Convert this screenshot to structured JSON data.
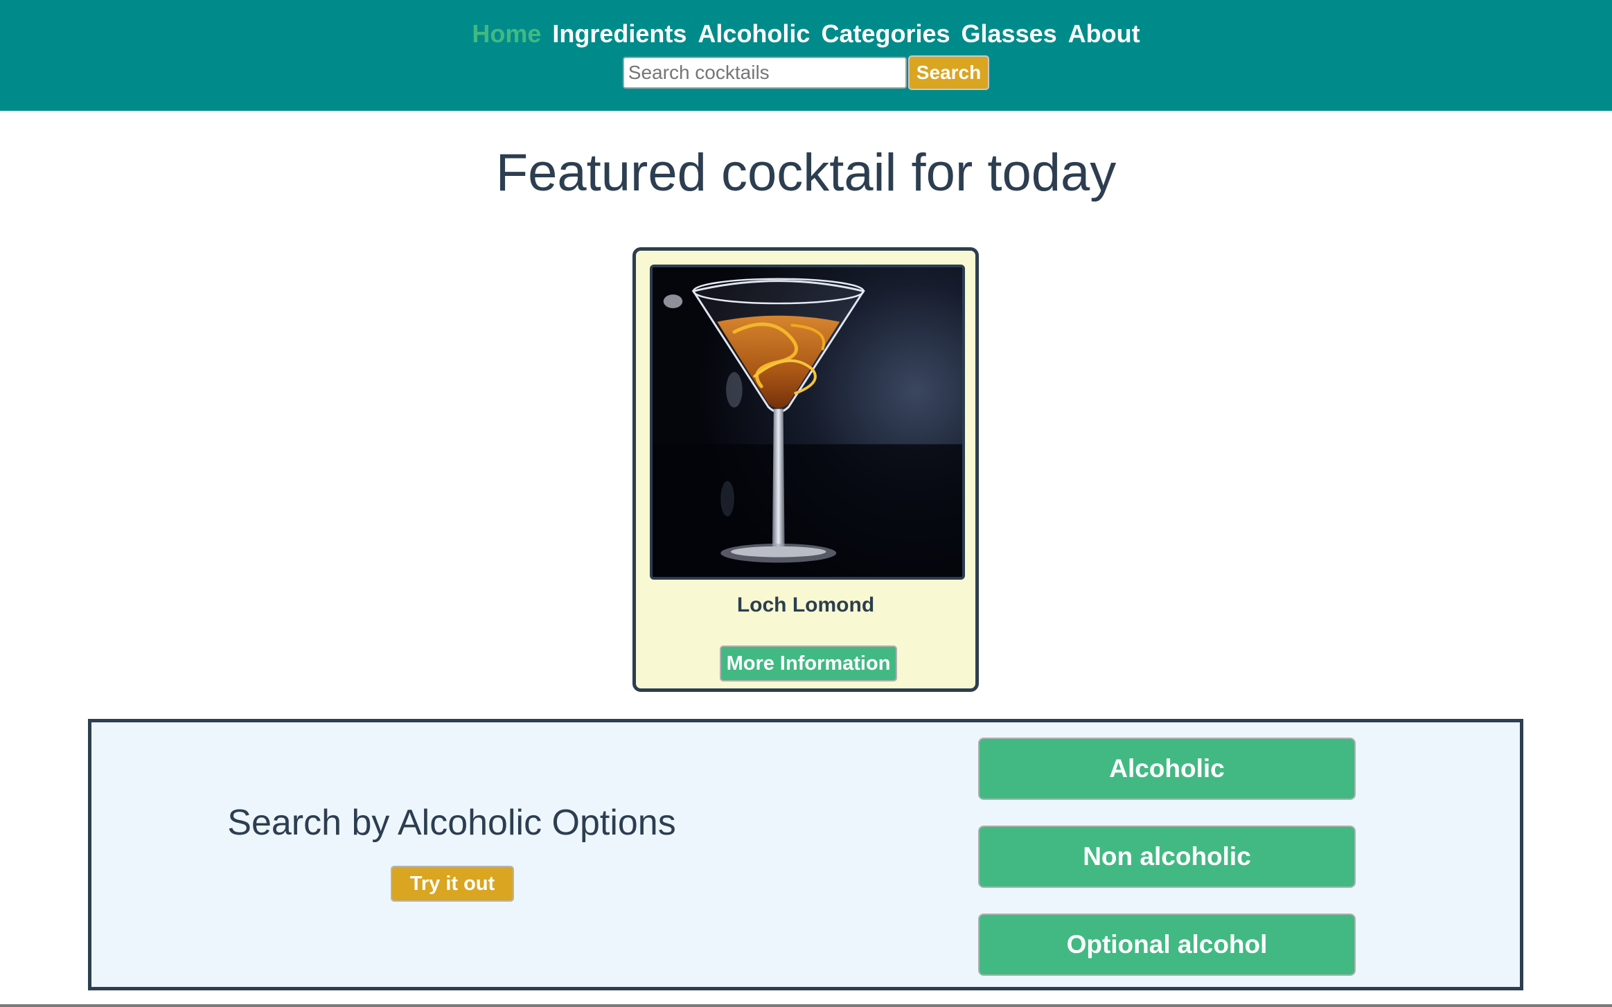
{
  "nav": {
    "items": [
      {
        "label": "Home",
        "active": true
      },
      {
        "label": "Ingredients",
        "active": false
      },
      {
        "label": "Alcoholic",
        "active": false
      },
      {
        "label": "Categories",
        "active": false
      },
      {
        "label": "Glasses",
        "active": false
      },
      {
        "label": "About",
        "active": false
      }
    ]
  },
  "search": {
    "placeholder": "Search cocktails",
    "value": "",
    "button_label": "Search"
  },
  "featured": {
    "title": "Featured cocktail for today",
    "cocktail_name": "Loch Lomond",
    "image_alt": "Loch Lomond",
    "more_button_label": "More Information"
  },
  "alcoholic_section": {
    "title": "Search by Alcoholic Options",
    "try_button_label": "Try it out",
    "options": [
      "Alcoholic",
      "Non alcoholic",
      "Optional alcohol"
    ]
  },
  "colors": {
    "header_bg": "#008b8b",
    "nav_active": "#42b983",
    "accent_gold": "#daa520",
    "accent_green": "#42b983",
    "text_dark": "#2c3e50",
    "card_bg": "#f8f8d2",
    "panel_bg": "#eef6fd"
  }
}
